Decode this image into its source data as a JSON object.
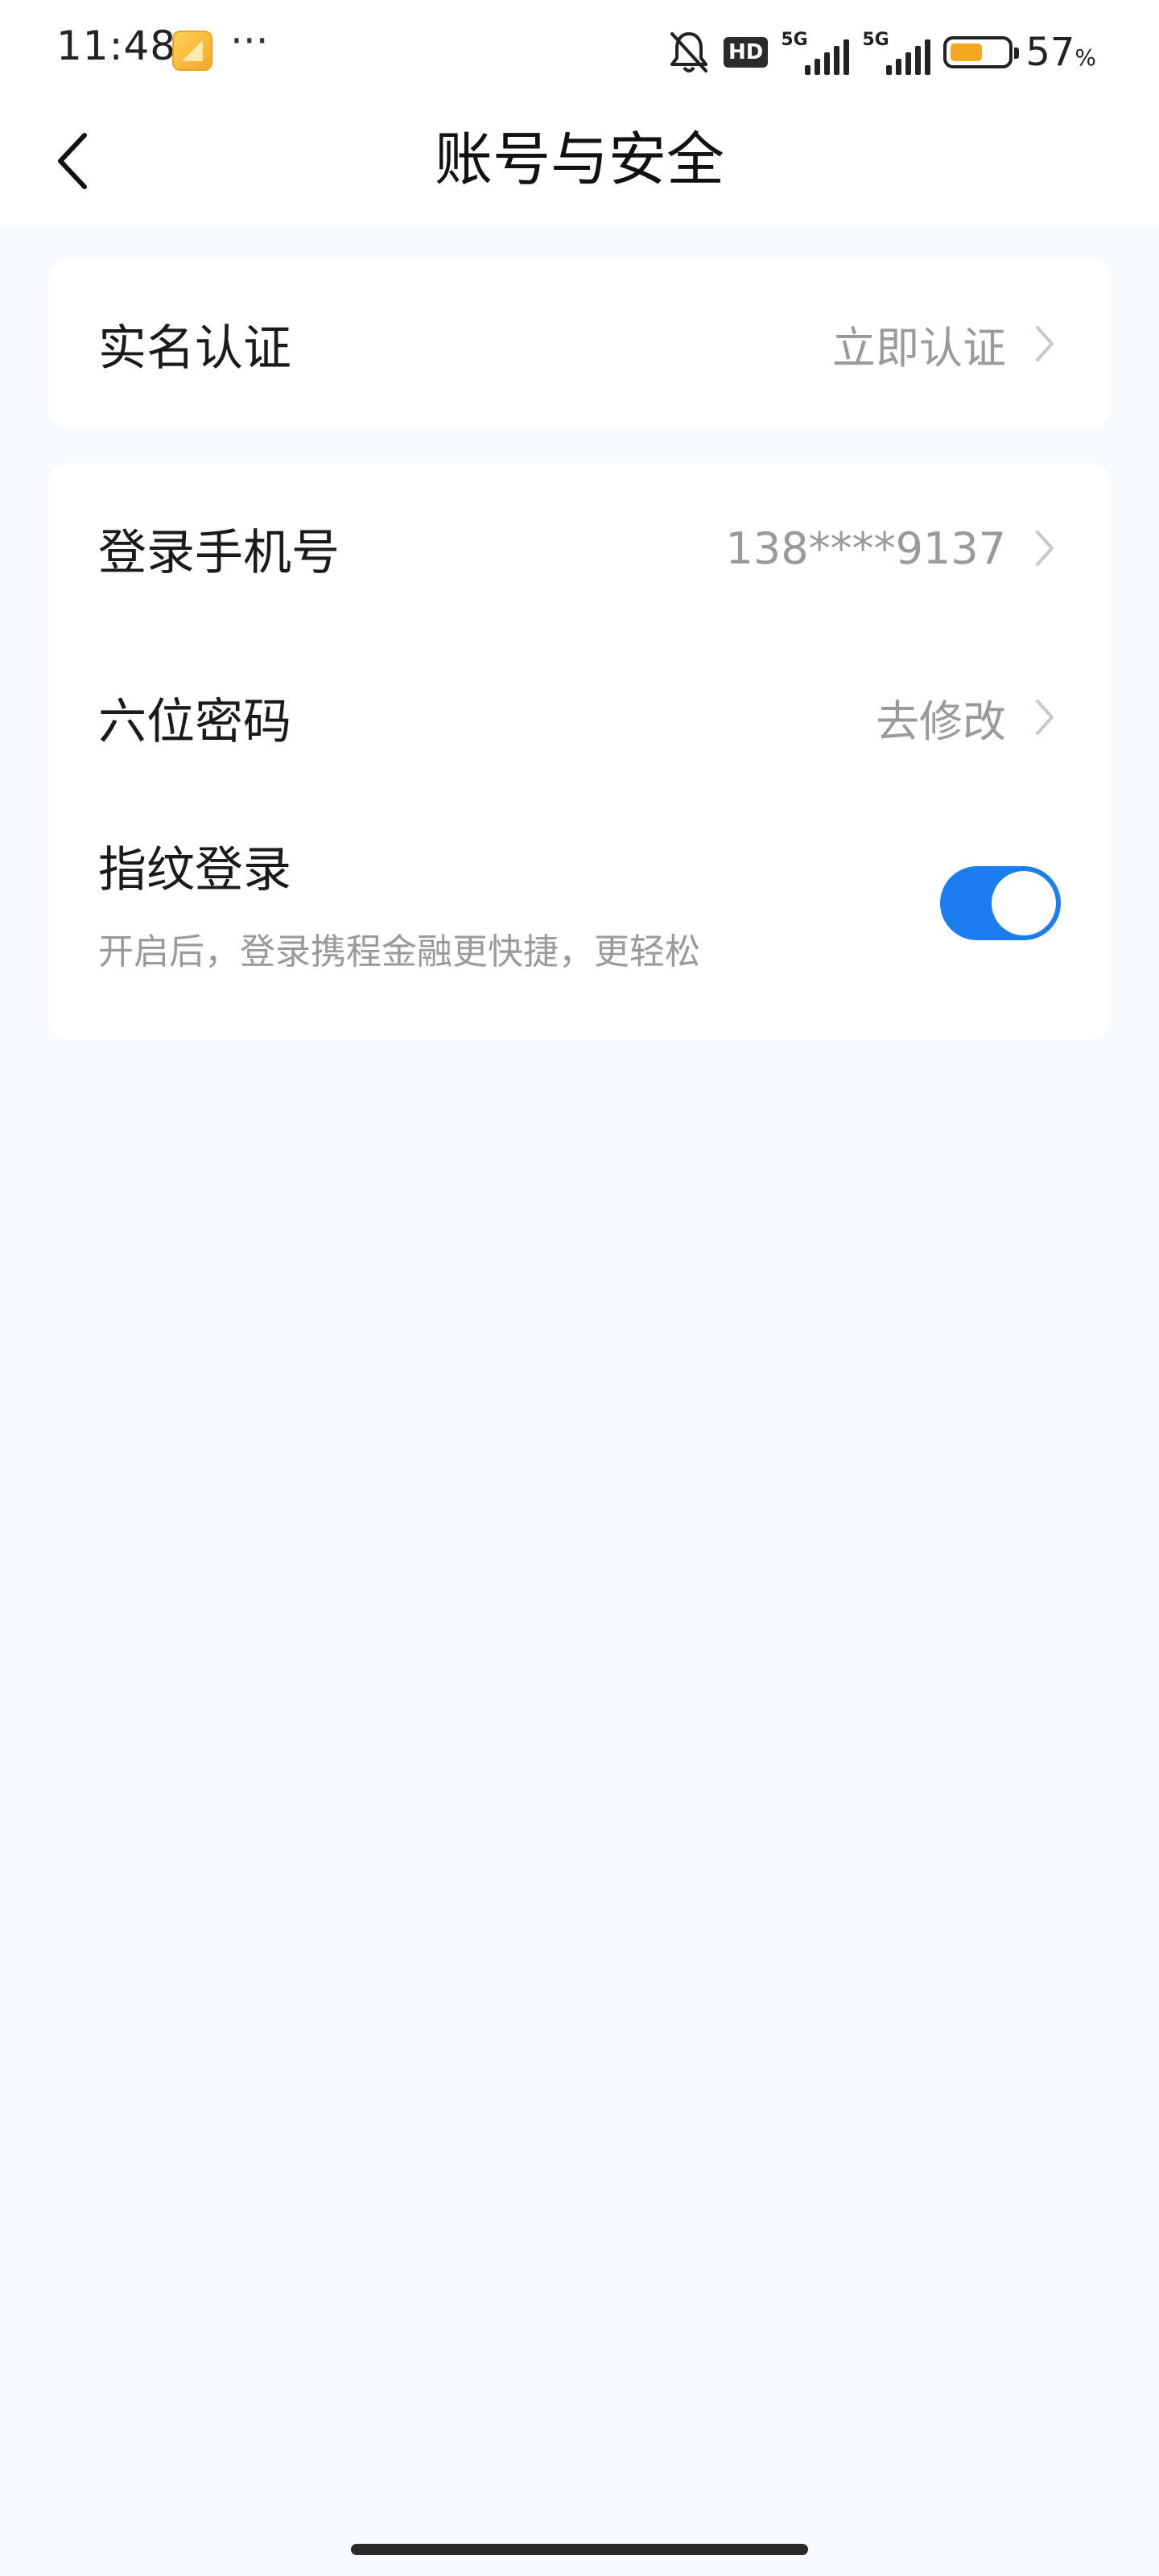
{
  "status_bar": {
    "time": "11:48",
    "more": "···",
    "hd": "HD",
    "network1": "5G",
    "network2": "5G",
    "battery_level": 0.57,
    "battery_percent": "57",
    "battery_unit": "%",
    "battery_color": "#f5a623",
    "icons": [
      "app-notification-icon",
      "bell-off-icon",
      "hd-icon",
      "signal-icon",
      "battery-icon"
    ]
  },
  "nav": {
    "title": "账号与安全",
    "back_icon": "chevron-left-icon"
  },
  "sections": {
    "verification": {
      "label": "实名认证",
      "value": "立即认证"
    },
    "phone": {
      "label": "登录手机号",
      "value": "138****9137"
    },
    "password": {
      "label": "六位密码",
      "value": "去修改"
    },
    "fingerprint": {
      "label": "指纹登录",
      "description": "开启后，登录携程金融更快捷，更轻松",
      "enabled": true
    }
  },
  "colors": {
    "accent": "#1a7ef0",
    "background": "#f8f9fc",
    "secondary_text": "#9a9a9a"
  }
}
